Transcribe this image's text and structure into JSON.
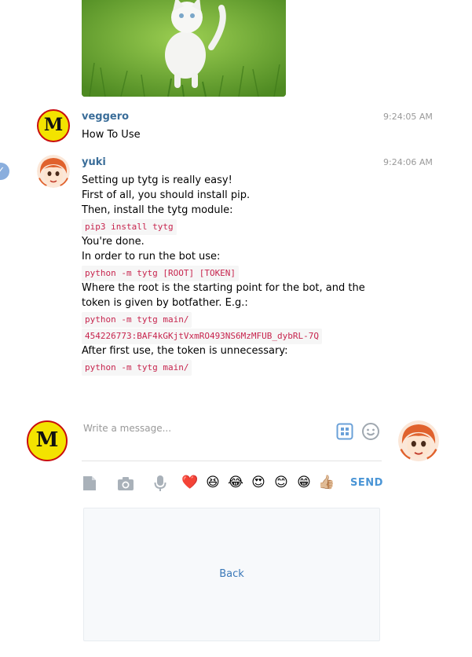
{
  "photo": {
    "alt": "white kitten in grass"
  },
  "messages": [
    {
      "author": "veggero",
      "time": "9:24:05 AM",
      "avatar_letter": "M",
      "text": "How To Use"
    },
    {
      "author": "yuki",
      "time": "9:24:06 AM",
      "lines": [
        {
          "t": "Setting up tytg is really easy!"
        },
        {
          "t": "First of all, you should install pip."
        },
        {
          "t": "Then, install the tytg module:"
        },
        {
          "code": "pip3 install tytg"
        },
        {
          "t": "You're done."
        },
        {
          "t": "In order to run the bot use:"
        },
        {
          "code": "python -m tytg [ROOT] [TOKEN]"
        },
        {
          "t": "Where the root is the starting point for the bot, and the"
        },
        {
          "t": "token is given by botfather. E.g.:"
        },
        {
          "code": "python -m tytg main/"
        },
        {
          "code": "454226773:BAF4kGKjtVxmRO493NS6MzMFUB_dybRL-7Q"
        },
        {
          "t": "After first use, the token is unnecessary:"
        },
        {
          "code": "python -m tytg main/"
        }
      ]
    }
  ],
  "composer": {
    "placeholder": "Write a message...",
    "value": "",
    "user_avatar_letter": "M",
    "emojis": [
      "❤️",
      "😆",
      "😂",
      "😍",
      "😊",
      "😁",
      "👍🏼"
    ],
    "send_label": "SEND"
  },
  "keyboard_panel": {
    "back_label": "Back"
  },
  "icons": {
    "check": "check-badge-icon",
    "commands": "command-grid-icon",
    "smile": "smile-icon",
    "file": "file-icon",
    "camera": "camera-icon",
    "mic": "microphone-icon"
  }
}
